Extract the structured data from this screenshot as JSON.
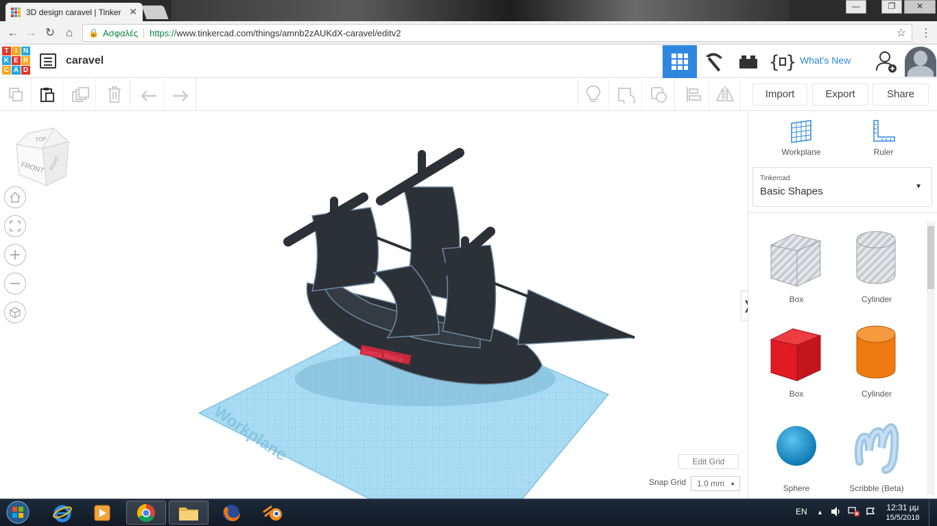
{
  "browser": {
    "tab_title": "3D design caravel | Tinker",
    "close_glyph": "✕",
    "window_controls": {
      "minimize": "—",
      "maximize": "❐",
      "close": "✕"
    },
    "nav": {
      "back": "←",
      "forward": "→",
      "reload": "↻",
      "home": "⌂"
    },
    "lock_glyph": "🔒",
    "secure_label": "Ασφαλές",
    "url_protocol": "https://",
    "url_rest": "www.tinkercad.com/things/amnb2zAUKdX-caravel/editv2",
    "star_glyph": "☆",
    "menu_glyph": "⋮"
  },
  "app": {
    "logo_letters": [
      "TIN",
      "KER",
      "CAD"
    ],
    "design_name": "caravel",
    "whats_new": "What's New"
  },
  "toolbar": {
    "import_label": "Import",
    "export_label": "Export",
    "share_label": "Share"
  },
  "viewport": {
    "view_cube": {
      "top": "TOP",
      "front": "FRONT",
      "right": "RIGHT"
    },
    "workplane_label": "Workplane",
    "ship_name": "Santa Maria",
    "edit_grid_label": "Edit Grid",
    "snap_grid_label": "Snap Grid",
    "snap_grid_value": "1.0 mm",
    "panel_toggle_glyph": "❭"
  },
  "right_panel": {
    "workplane_label": "Workplane",
    "ruler_label": "Ruler",
    "library_owner": "Tinkercad",
    "library_name": "Basic Shapes",
    "caret_glyph": "▼",
    "shapes": [
      {
        "name": "Box",
        "icon": "box-hole-icon"
      },
      {
        "name": "Cylinder",
        "icon": "cylinder-hole-icon"
      },
      {
        "name": "Box",
        "icon": "box-solid-icon"
      },
      {
        "name": "Cylinder",
        "icon": "cylinder-solid-icon"
      },
      {
        "name": "Sphere",
        "icon": "sphere-icon"
      },
      {
        "name": "Scribble (Beta)",
        "icon": "scribble-icon"
      }
    ]
  },
  "taskbar": {
    "language": "EN",
    "tray_up": "▲",
    "time": "12:31 μμ",
    "date": "15/5/2018"
  },
  "colors": {
    "accent_blue": "#2e86de",
    "ship_dark": "#2b3137",
    "workplane_blue": "#9ad3ee",
    "box_red": "#e01b24",
    "cylinder_orange": "#ee7b11",
    "sphere_blue": "#1597d5"
  }
}
